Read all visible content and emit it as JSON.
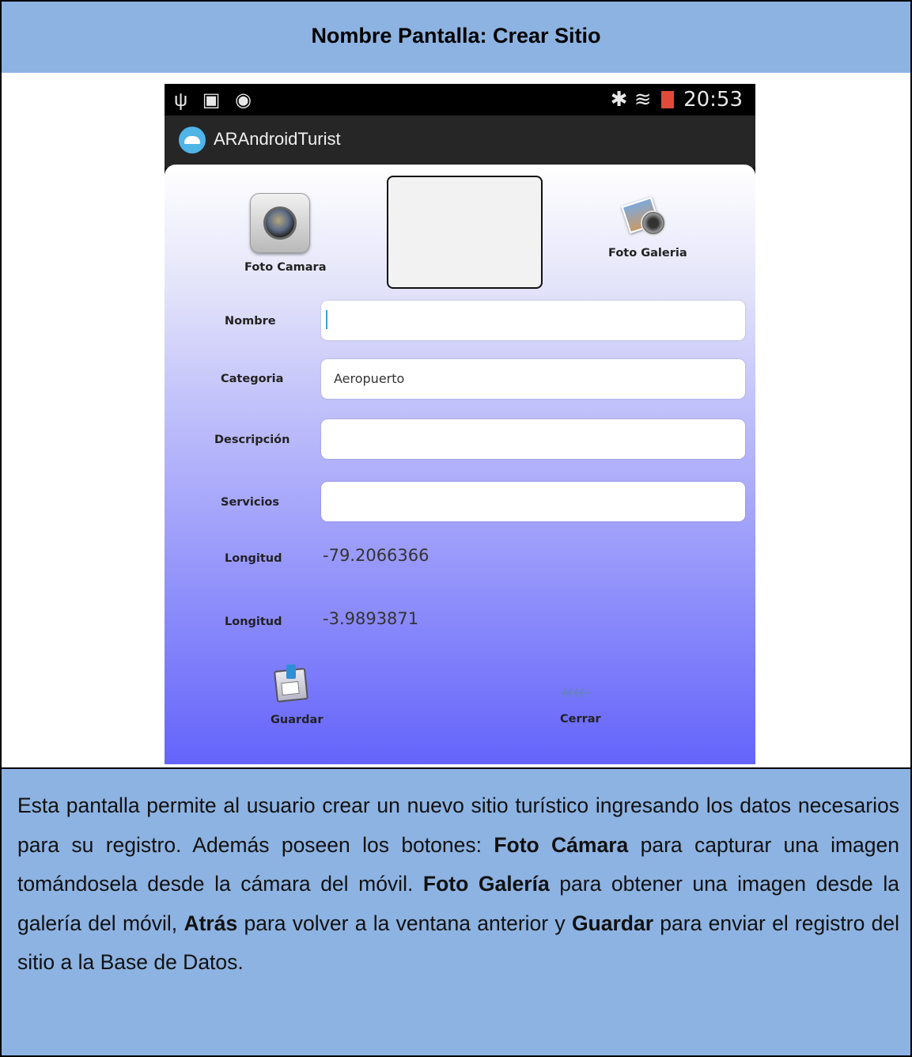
{
  "document": {
    "title": "Nombre Pantalla: Crear Sitio",
    "description": {
      "p1": "Esta pantalla permite al usuario crear un nuevo sitio turístico ingresando los datos necesarios para su registro. Además poseen los botones: ",
      "b1": "Foto Cámara",
      "p2": " para capturar una imagen tomándosela desde la cámara del móvil. ",
      "b2": "Foto Galería",
      "p3": " para obtener una imagen desde la galería del móvil, ",
      "b3": "Atrás",
      "p4": " para volver a la ventana anterior y ",
      "b4": "Guardar",
      "p5": " para enviar el registro del sitio a la Base de Datos."
    }
  },
  "status_bar": {
    "left_icons": [
      "usb-icon",
      "image-notification-icon",
      "check-notification-icon"
    ],
    "left_glyphs": "ψ ▣ ◉",
    "right_icons": [
      "bluetooth-icon",
      "wifi-icon",
      "battery-icon"
    ],
    "bluetooth": "✱",
    "wifi": "≋",
    "time": "20:53"
  },
  "action_bar": {
    "app_name": "ARAndroidTurist"
  },
  "form": {
    "foto_camara_label": "Foto Camara",
    "foto_galeria_label": "Foto Galeria",
    "fields": [
      {
        "label": "Nombre",
        "value": ""
      },
      {
        "label": "Categoria",
        "value": "Aeropuerto"
      },
      {
        "label": "Descripción",
        "value": ""
      },
      {
        "label": "Servicios",
        "value": ""
      }
    ],
    "longitud_label": "Longitud",
    "longitud_value": "-79.2066366",
    "latitud_label": "Longitud",
    "latitud_value": "-3.9893871",
    "guardar_label": "Guardar",
    "cerrar_label": "Cerrar",
    "cerrar_glyph": "↞↞"
  },
  "colors": {
    "table_header_bg": "#8db3e2",
    "gradient_top": "#ffffff",
    "gradient_bottom": "#6464fb",
    "app_icon": "#4fb4e6"
  }
}
